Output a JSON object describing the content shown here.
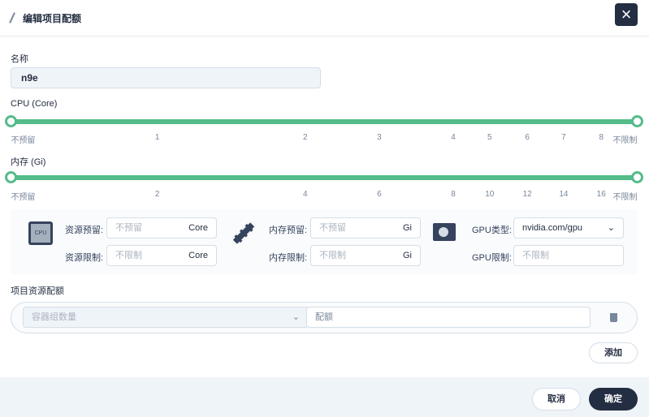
{
  "header": {
    "title": "编辑项目配额"
  },
  "name": {
    "label": "名称",
    "value": "n9e"
  },
  "cpu": {
    "label": "CPU (Core)",
    "ticks": [
      "不预留",
      "1",
      "2",
      "3",
      "4",
      "5",
      "6",
      "7",
      "8",
      "不限制"
    ],
    "range": [
      "不预留",
      "不限制"
    ]
  },
  "memory": {
    "label": "内存 (Gi)",
    "ticks": [
      "不预留",
      "2",
      "4",
      "6",
      "8",
      "10",
      "12",
      "14",
      "16",
      "不限制"
    ],
    "range": [
      "不预留",
      "不限制"
    ]
  },
  "resources": {
    "cpu_icon_text": "CPU",
    "cpu_request_label": "资源预留:",
    "cpu_request_placeholder": "不预留",
    "cpu_limit_label": "资源限制:",
    "cpu_limit_placeholder": "不限制",
    "cpu_unit": "Core",
    "mem_request_label": "内存预留:",
    "mem_request_placeholder": "不预留",
    "mem_limit_label": "内存限制:",
    "mem_limit_placeholder": "不限制",
    "mem_unit": "Gi",
    "gpu_type_label": "GPU类型:",
    "gpu_type_value": "nvidia.com/gpu",
    "gpu_limit_label": "GPU限制:",
    "gpu_limit_placeholder": "不限制"
  },
  "quota": {
    "label": "项目资源配额",
    "select_placeholder": "容器组数量",
    "input_placeholder": "配额",
    "add_label": "添加"
  },
  "footer": {
    "cancel": "取消",
    "ok": "确定"
  }
}
